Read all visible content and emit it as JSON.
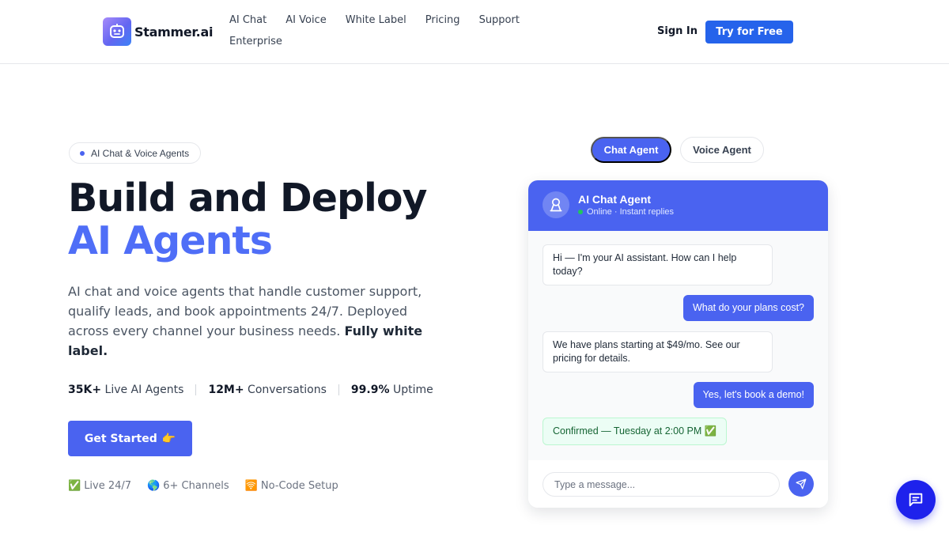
{
  "header": {
    "logo_text": "Stammer.ai",
    "nav_row1": [
      "AI Chat",
      "AI Voice",
      "White Label",
      "Pricing",
      "Support"
    ],
    "nav_row2": [
      "Enterprise"
    ],
    "sign_in": "Sign In",
    "try_free": "Try for Free"
  },
  "hero": {
    "badge": "AI Chat & Voice Agents",
    "title_line1": "Build and Deploy",
    "title_line2": "AI Agents",
    "desc_main": "AI chat and voice agents that handle customer support, qualify leads, and book appointments 24/7. Deployed across every channel your business needs. ",
    "desc_bold": "Fully white label.",
    "stats": [
      {
        "value": "35K+",
        "label": " Live AI Agents"
      },
      {
        "value": "12M+",
        "label": " Conversations"
      },
      {
        "value": "99.9%",
        "label": " Uptime"
      }
    ],
    "cta": "Get Started",
    "cta_emoji": "👉",
    "features": [
      {
        "emoji": "✅",
        "label": "Live 24/7"
      },
      {
        "emoji": "🌎",
        "label": "6+ Channels"
      },
      {
        "emoji": "🛜",
        "label": "No-Code Setup"
      }
    ]
  },
  "demo": {
    "tabs": {
      "chat": "Chat Agent",
      "voice": "Voice Agent"
    },
    "agent_name": "AI Chat Agent",
    "agent_status": "Online · Instant replies",
    "messages": [
      {
        "from": "bot",
        "text": "Hi — I'm your AI assistant. How can I help today?"
      },
      {
        "from": "user",
        "text": "What do your plans cost?"
      },
      {
        "from": "bot",
        "text": "We have plans starting at $49/mo. See our pricing for details."
      },
      {
        "from": "user",
        "text": "Yes, let's book a demo!"
      },
      {
        "from": "confirm",
        "text": "Confirmed — Tuesday at 2:00 PM ✅"
      }
    ],
    "input_placeholder": "Type a message..."
  },
  "colors": {
    "accent": "#4a63f0",
    "primary_button": "#2563eb",
    "fab": "#1e22ec"
  },
  "icons": {
    "logo": "robot-face-icon",
    "agent_avatar": "robot-icon",
    "send": "paper-plane-icon",
    "fab": "chat-bubble-icon"
  }
}
